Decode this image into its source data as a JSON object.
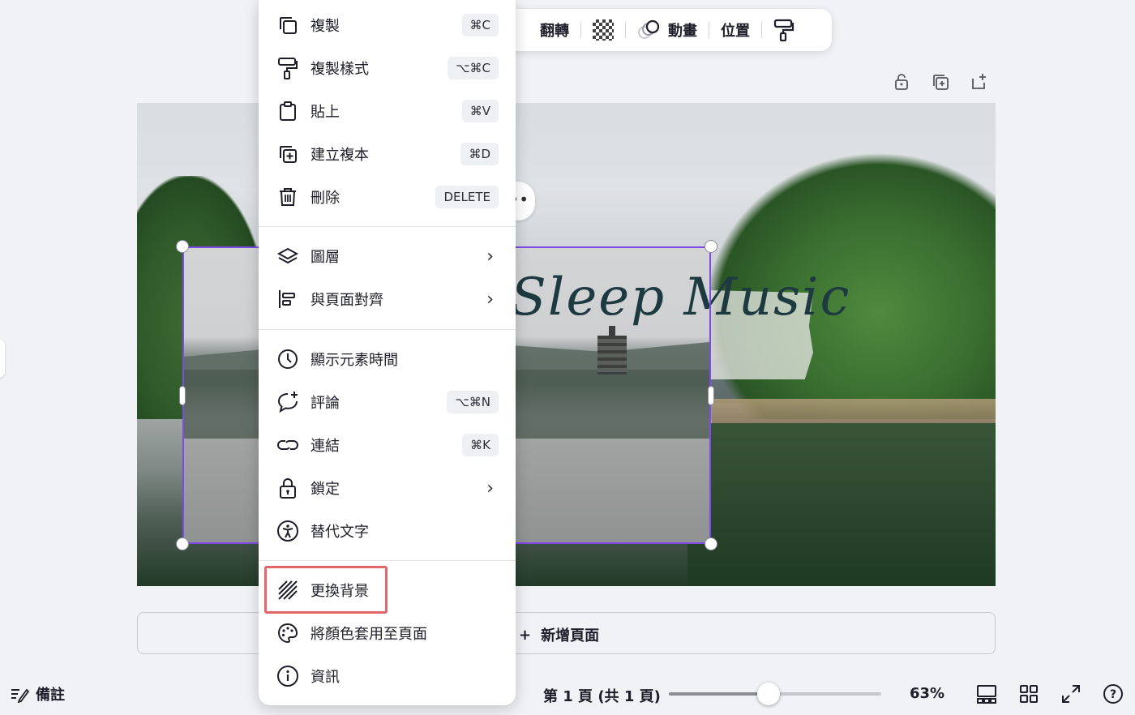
{
  "toolbar": {
    "flip_label": "翻轉",
    "transparency_icon": "checkerboard-icon",
    "animate_label": "動畫",
    "position_label": "位置"
  },
  "canvas": {
    "title_text": "Sleep Music"
  },
  "context_menu": {
    "items": [
      {
        "label": "複製",
        "shortcut": "⌘C",
        "icon": "copy-icon"
      },
      {
        "label": "複製樣式",
        "shortcut": "⌥⌘C",
        "icon": "paint-roller-icon"
      },
      {
        "label": "貼上",
        "shortcut": "⌘V",
        "icon": "clipboard-icon"
      },
      {
        "label": "建立複本",
        "shortcut": "⌘D",
        "icon": "duplicate-icon"
      },
      {
        "label": "刪除",
        "shortcut": "DELETE",
        "icon": "trash-icon"
      },
      {
        "label": "圖層",
        "icon": "layers-icon"
      },
      {
        "label": "與頁面對齊",
        "icon": "align-icon"
      },
      {
        "label": "顯示元素時間",
        "icon": "clock-icon"
      },
      {
        "label": "評論",
        "shortcut": "⌥⌘N",
        "icon": "comment-icon"
      },
      {
        "label": "連結",
        "shortcut": "⌘K",
        "icon": "link-icon"
      },
      {
        "label": "鎖定",
        "icon": "lock-icon"
      },
      {
        "label": "替代文字",
        "icon": "accessibility-icon"
      },
      {
        "label": "更換背景",
        "icon": "background-icon"
      },
      {
        "label": "將顏色套用至頁面",
        "icon": "palette-icon"
      },
      {
        "label": "資訊",
        "icon": "info-icon"
      }
    ]
  },
  "add_page": {
    "label": "新增頁面",
    "icon": "+"
  },
  "footer": {
    "notes_label": "備註",
    "page_indicator": "第 1 頁 (共 1 頁)",
    "zoom_value": "63%",
    "zoom_fraction": 0.47
  },
  "colors": {
    "selection": "#7d4be6",
    "highlight": "#e3676a"
  }
}
